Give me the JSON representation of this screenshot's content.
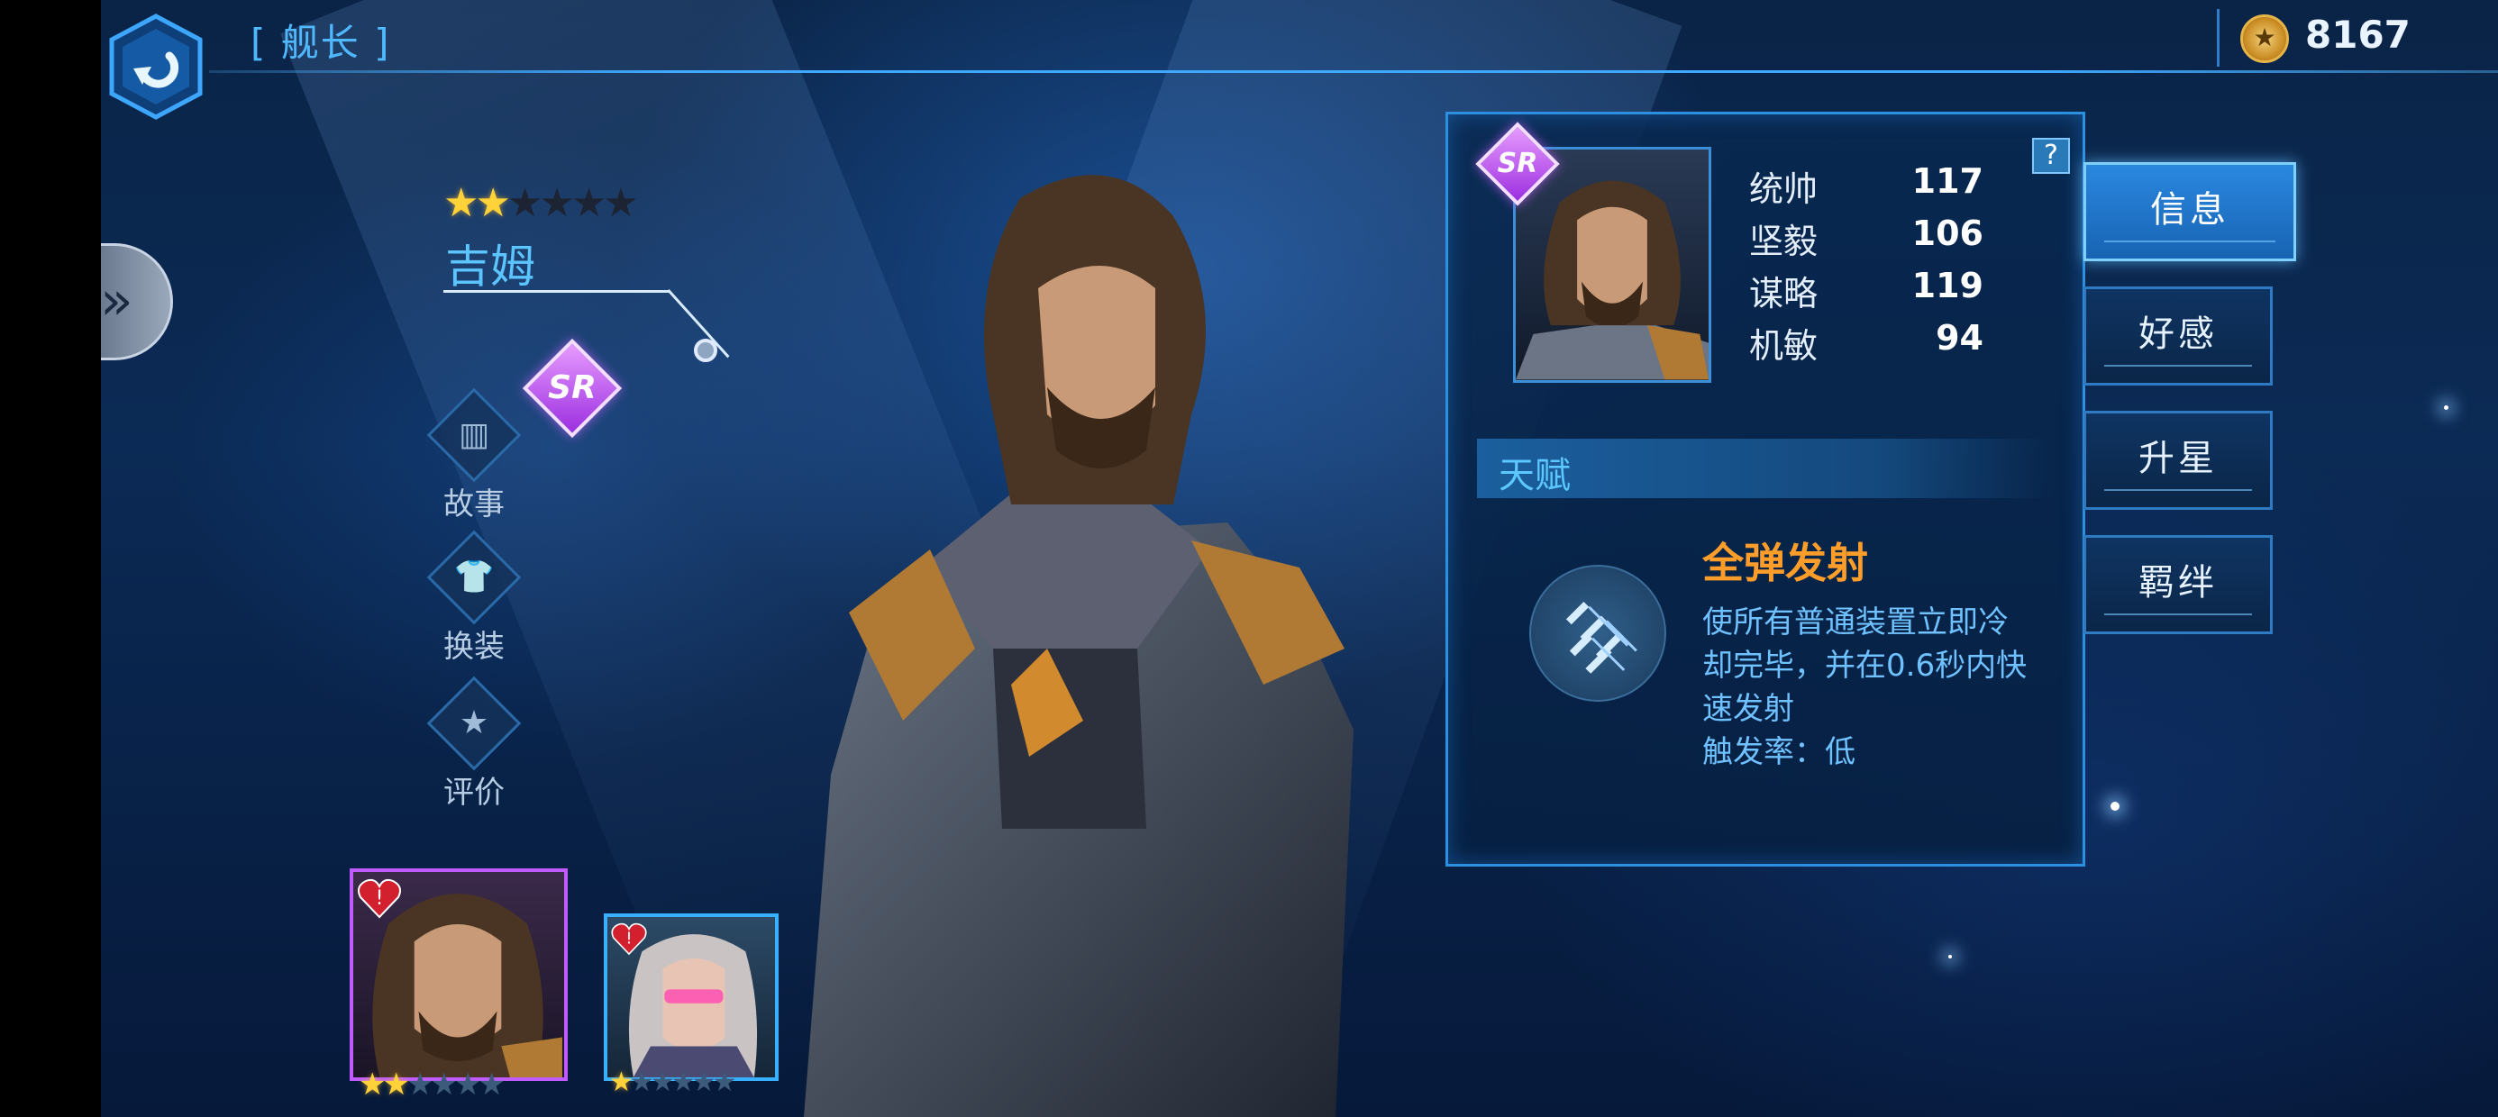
{
  "header": {
    "title": "[ 舰长 ]",
    "coin_value": "8167"
  },
  "hero": {
    "name": "吉姆",
    "rarity": "SR",
    "stars_filled": 2,
    "stars_total": 6
  },
  "side_actions": [
    {
      "label": "故事",
      "icon": "book-icon"
    },
    {
      "label": "换装",
      "icon": "shirt-icon"
    },
    {
      "label": "评价",
      "icon": "review-icon"
    }
  ],
  "panel": {
    "help": "?",
    "rarity": "SR",
    "stats": [
      {
        "name": "统帅",
        "value": "117"
      },
      {
        "name": "坚毅",
        "value": "106"
      },
      {
        "name": "谋略",
        "value": "119"
      },
      {
        "name": "机敏",
        "value": "94"
      }
    ],
    "talent_title": "天赋",
    "skill_name": "全弹发射",
    "skill_desc": [
      "使所有普通装置立即冷",
      "却完毕，并在0.6秒内快",
      "速发射",
      "触发率：低"
    ]
  },
  "tabs": [
    {
      "label": "信息",
      "active": true
    },
    {
      "label": "好感",
      "active": false
    },
    {
      "label": "升星",
      "active": false
    },
    {
      "label": "羁绊",
      "active": false
    }
  ],
  "captains": [
    {
      "name": "吉姆",
      "stars_filled": 2,
      "stars_total": 6,
      "selected": true
    },
    {
      "name": "captain-2",
      "stars_filled": 1,
      "stars_total": 6,
      "selected": false
    }
  ],
  "colors": {
    "accent": "#3fa9ff",
    "rarity_sr": "#b84cff",
    "skill_name": "#ff9d2a",
    "desc_text": "#6fc2ff"
  }
}
